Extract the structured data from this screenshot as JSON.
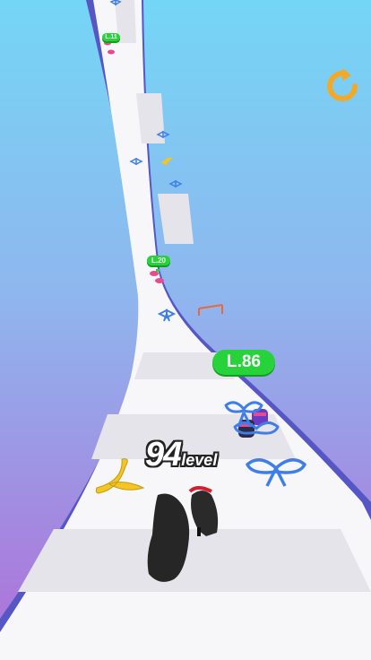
{
  "player": {
    "level_number": "94",
    "level_word": "level"
  },
  "badges": {
    "near": "L.86",
    "mid": "L.20",
    "far": "L.11"
  },
  "colors": {
    "sky_top": "#74d6f6",
    "sky_bottom": "#b06ed8",
    "road": "#f7f7f9",
    "road_stripe": "#e4e4ea",
    "road_edge": "#5656c4",
    "badge": "#27d23b",
    "restart": "#f2a92a",
    "ribbon": "#3f7ee8"
  },
  "icons": {
    "restart": "restart-icon",
    "banana": "banana-icon",
    "ribbon": "ribbon-bow-icon",
    "shoe": "shoe-icon"
  }
}
